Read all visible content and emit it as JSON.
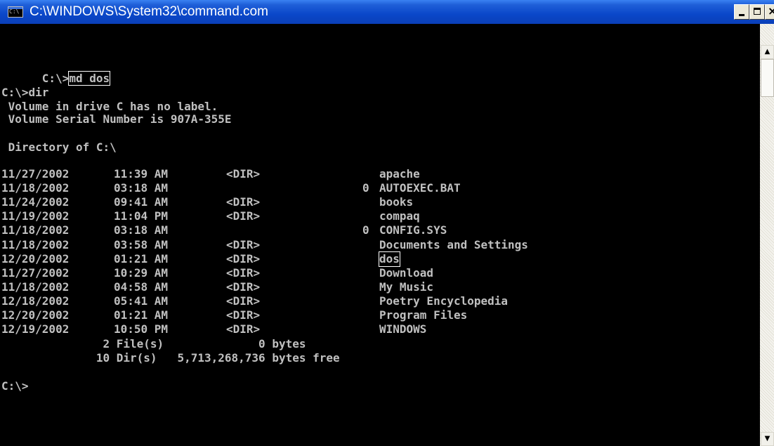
{
  "window": {
    "title": "C:\\WINDOWS\\System32\\command.com",
    "icon": "console-icon",
    "icon_glyph": "C:\\",
    "buttons": {
      "minimize": "minimize-icon",
      "maximize": "maximize-icon",
      "close": "close-icon",
      "close_glyph": "×"
    }
  },
  "console": {
    "prompt_md": "C:\\>",
    "cmd_md": "md dos",
    "prompt_dir": "C:\\>dir",
    "volume_label": " Volume in drive C has no label.",
    "volume_serial": " Volume Serial Number is 907A-355E",
    "directory_of": " Directory of C:\\",
    "entries": [
      {
        "date": "11/27/2002",
        "time": "11:39 AM",
        "dir": "<DIR>",
        "size": "",
        "name": "apache"
      },
      {
        "date": "11/18/2002",
        "time": "03:18 AM",
        "dir": "",
        "size": "0",
        "name": "AUTOEXEC.BAT"
      },
      {
        "date": "11/24/2002",
        "time": "09:41 AM",
        "dir": "<DIR>",
        "size": "",
        "name": "books"
      },
      {
        "date": "11/19/2002",
        "time": "11:04 PM",
        "dir": "<DIR>",
        "size": "",
        "name": "compaq"
      },
      {
        "date": "11/18/2002",
        "time": "03:18 AM",
        "dir": "",
        "size": "0",
        "name": "CONFIG.SYS"
      },
      {
        "date": "11/18/2002",
        "time": "03:58 AM",
        "dir": "<DIR>",
        "size": "",
        "name": "Documents and Settings"
      },
      {
        "date": "12/20/2002",
        "time": "01:21 AM",
        "dir": "<DIR>",
        "size": "",
        "name": "dos"
      },
      {
        "date": "11/27/2002",
        "time": "10:29 AM",
        "dir": "<DIR>",
        "size": "",
        "name": "Download"
      },
      {
        "date": "11/18/2002",
        "time": "04:58 AM",
        "dir": "<DIR>",
        "size": "",
        "name": "My Music"
      },
      {
        "date": "12/18/2002",
        "time": "05:41 AM",
        "dir": "<DIR>",
        "size": "",
        "name": "Poetry Encyclopedia"
      },
      {
        "date": "12/20/2002",
        "time": "01:21 AM",
        "dir": "<DIR>",
        "size": "",
        "name": "Program Files"
      },
      {
        "date": "12/19/2002",
        "time": "10:50 PM",
        "dir": "<DIR>",
        "size": "",
        "name": "WINDOWS"
      }
    ],
    "summary_files": "               2 File(s)              0 bytes",
    "summary_dirs": "              10 Dir(s)   5,713,268,736 bytes free",
    "final_prompt": "C:\\>"
  },
  "scrollbar": {
    "up_glyph": "▲",
    "down_glyph": "▼"
  }
}
